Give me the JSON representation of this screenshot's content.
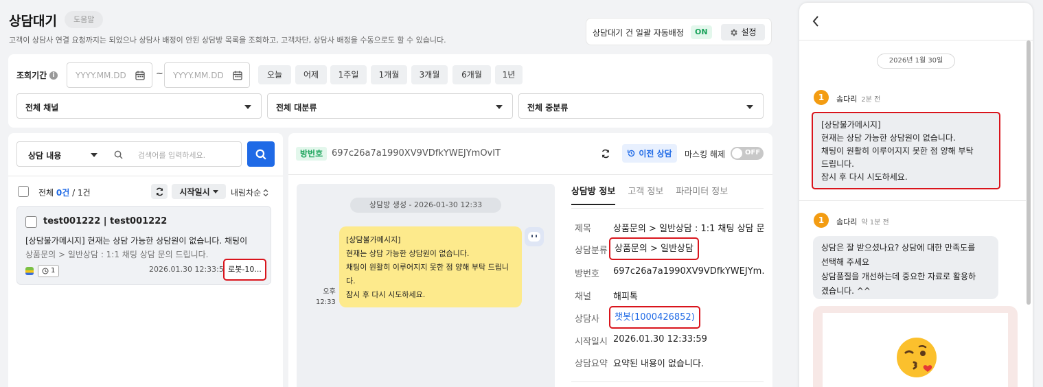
{
  "header": {
    "title": "상담대기",
    "help_label": "도움말",
    "description": "고객이 상담사 연결 요청까지는 되었으나 상담사 배정이 안된 상담방 목록을 조회하고, 고객차단, 상담사 배정을 수동으로도 할 수 있습니다.",
    "auto_assign_label": "상담대기 건 일괄 자동배정",
    "auto_assign_state": "ON",
    "settings_label": "설정"
  },
  "filter": {
    "period_label": "조회기간",
    "date_from_placeholder": "YYYY.MM.DD",
    "date_to_placeholder": "YYYY.MM.DD",
    "tilde": "~",
    "quick_ranges": [
      "오늘",
      "어제",
      "1주일",
      "1개월",
      "3개월",
      "6개월",
      "1년"
    ],
    "channel_select": "전체 채널",
    "major_category_select": "전체 대분류",
    "middle_category_select": "전체 중분류"
  },
  "list": {
    "search_type": "상담 내용",
    "search_placeholder": "검색어를 입력하세요.",
    "count_prefix": "전체",
    "count_selected": "0건",
    "count_total": "/ 1건",
    "sort_field": "시작일시",
    "sort_order": "내림차순",
    "items": [
      {
        "title": "test001222 | test001222",
        "message": "[상담불가메시지] 현재는 상담 가능한 상담원이 없습니다. 채팅이",
        "category": "상품문의 > 일반상담 : 1:1 채팅 상담 문의 드립니다.",
        "timer_count": "1",
        "date": "2026.01.30 12:33:59",
        "agent": "로봇-10..."
      }
    ]
  },
  "detail": {
    "room_badge": "방번호",
    "room_id": "697c26a7a1990XV9VDfkYWEJYmOvIT",
    "prev_button": "이전 상담",
    "mask_label": "마스킹 해제",
    "mask_state": "OFF",
    "chat": {
      "room_created": "상담방 생성 - 2026-01-30 12:33",
      "bot_message_lines": [
        "[상담불가메시지]",
        "현재는 상담 가능한 상담원이 없습니다.",
        "채팅이 원활히 이루어지지 못한 점 양해 부탁 드립니",
        "다.",
        "잠시 후 다시 시도하세요."
      ],
      "time_ampm": "오후",
      "time_hm": "12:33"
    },
    "tabs": [
      "상담방 정보",
      "고객 정보",
      "파라미터 정보"
    ],
    "info": {
      "subject_key": "제목",
      "subject_val": "상품문의 > 일반상담 : 1:1 채팅 상담 문...",
      "category_key": "상담분류",
      "category_val": "상품문의 > 일반상담",
      "room_key": "방번호",
      "room_val": "697c26a7a1990XV9VDfkYWEJYm...",
      "channel_key": "채널",
      "channel_val": "해피톡",
      "agent_key": "상담사",
      "agent_val": "챗봇(1000426852)",
      "start_key": "시작일시",
      "start_val": "2026.01.30 12:33:59",
      "summary_key": "상담요약",
      "summary_val": "요약된 내용이 없습니다."
    }
  },
  "right_panel": {
    "date": "2026년 1월 30일",
    "msg1": {
      "num": "1",
      "sender": "솜다리",
      "time": "2분 전",
      "lines": [
        "[상담불가메시지]",
        "현재는 상담 가능한 상담원이 없습니다.",
        "채팅이 원활히 이루어지지 못한 점 양해 부탁",
        "드립니다.",
        "잠시 후 다시 시도하세요."
      ]
    },
    "msg2": {
      "num": "1",
      "sender": "솜다리",
      "time": "약 1분 전",
      "lines": [
        "상담은 잘 받으셨나요? 상담에 대한 만족도를",
        "선택해 주세요",
        "상담품질을 개선하는데 중요한 자료로 활용하",
        "겠습니다. ^^"
      ]
    }
  },
  "colors": {
    "accent_blue": "#1f6ae6",
    "highlight_red": "#d9141c",
    "on_green": "#1aa35a",
    "bot_bubble_yellow": "#fdea8c"
  }
}
